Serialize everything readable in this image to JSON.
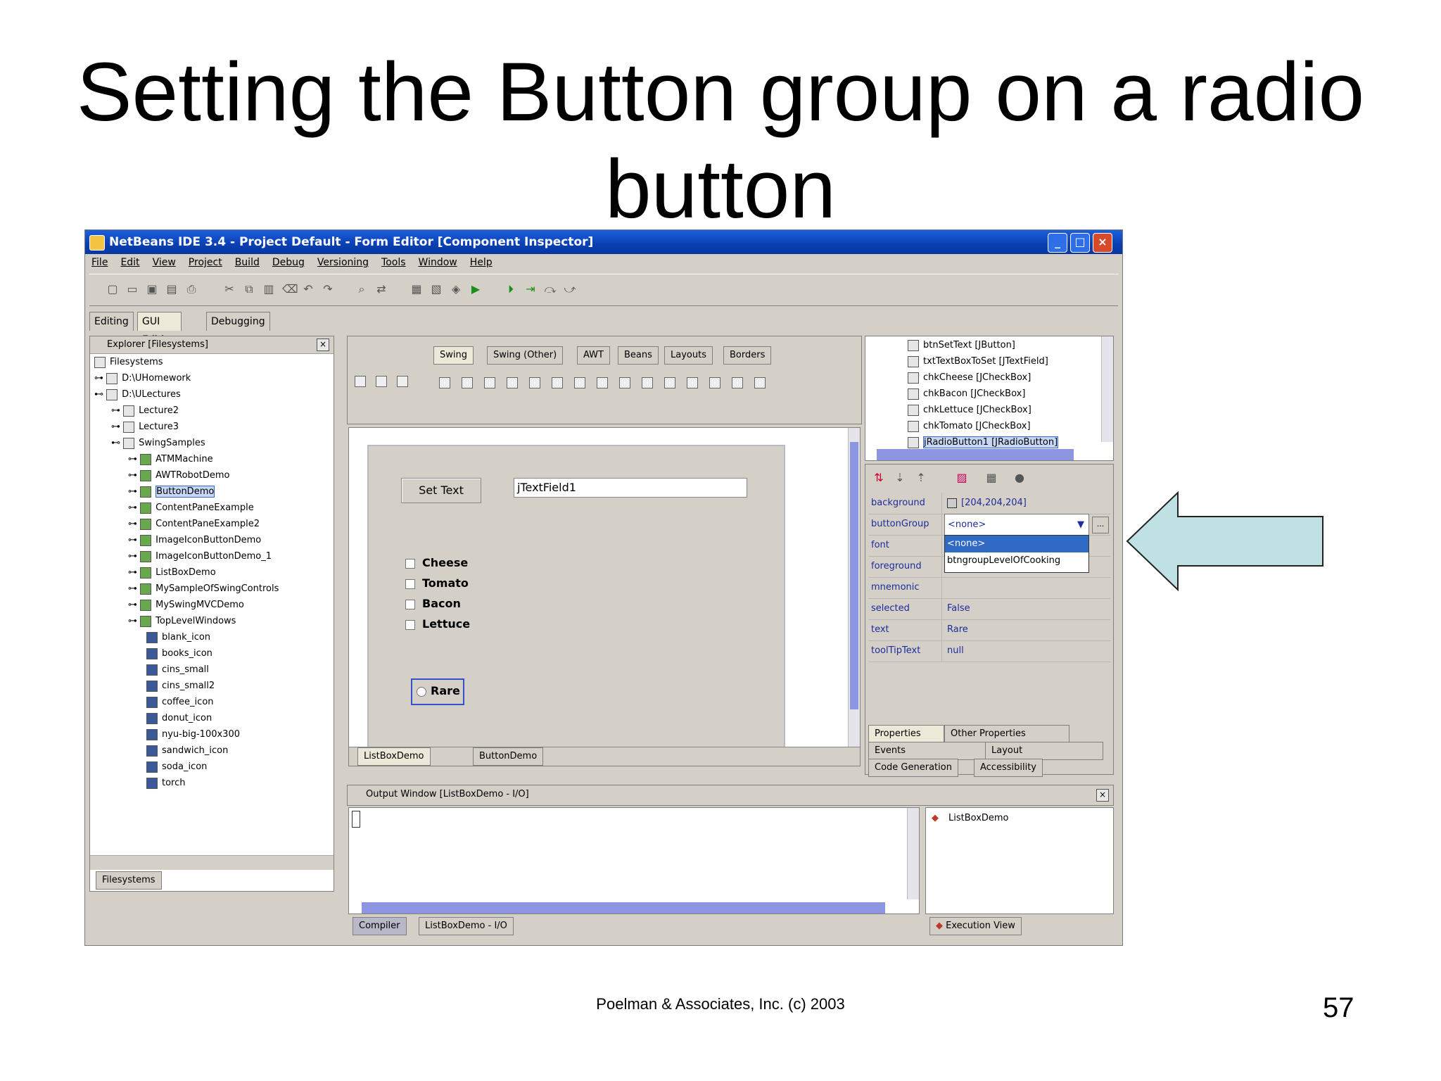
{
  "slide": {
    "title_line1": "Setting the Button group on a radio",
    "title_line2": "button",
    "footer": "Poelman & Associates, Inc. (c) 2003",
    "page_number": "57"
  },
  "window": {
    "title": "NetBeans IDE 3.4 - Project Default - Form Editor [Component Inspector]",
    "menu": [
      "File",
      "Edit",
      "View",
      "Project",
      "Build",
      "Debug",
      "Versioning",
      "Tools",
      "Window",
      "Help"
    ],
    "workspace_tabs": [
      "Editing",
      "GUI Editing",
      "Debugging"
    ]
  },
  "explorer": {
    "title": "Explorer [Filesystems]",
    "items": [
      "Filesystems",
      "D:\\UHomework",
      "D:\\ULectures",
      "Lecture2",
      "Lecture3",
      "SwingSamples",
      "ATMMachine",
      "AWTRobotDemo",
      "ButtonDemo",
      "ContentPaneExample",
      "ContentPaneExample2",
      "ImageIconButtonDemo",
      "ImageIconButtonDemo_1",
      "ListBoxDemo",
      "MySampleOfSwingControls",
      "MySwingMVCDemo",
      "TopLevelWindows",
      "blank_icon",
      "books_icon",
      "cins_small",
      "cins_small2",
      "coffee_icon",
      "donut_icon",
      "nyu-big-100x300",
      "sandwich_icon",
      "soda_icon",
      "torch"
    ],
    "tab": "Filesystems"
  },
  "palette": {
    "tabs": [
      "Swing",
      "Swing (Other)",
      "AWT",
      "Beans",
      "Layouts",
      "Borders"
    ]
  },
  "form": {
    "button_label": "Set Text",
    "textfield_value": "jTextField1",
    "checkboxes": [
      "Cheese",
      "Tomato",
      "Bacon",
      "Lettuce"
    ],
    "radio_label": "Rare",
    "doc_tabs": [
      "ListBoxDemo",
      "ButtonDemo"
    ]
  },
  "inspector": {
    "components": [
      "btnSetText [JButton]",
      "txtTextBoxToSet [JTextField]",
      "chkCheese [JCheckBox]",
      "chkBacon [JCheckBox]",
      "chkLettuce [JCheckBox]",
      "chkTomato [JCheckBox]",
      "jRadioButton1 [JRadioButton]"
    ],
    "properties": [
      {
        "name": "background",
        "value": "[204,204,204]"
      },
      {
        "name": "buttonGroup",
        "value": "<none>"
      },
      {
        "name": "font",
        "value": ""
      },
      {
        "name": "foreground",
        "value": ""
      },
      {
        "name": "mnemonic",
        "value": ""
      },
      {
        "name": "selected",
        "value": "False"
      },
      {
        "name": "text",
        "value": "Rare"
      },
      {
        "name": "toolTipText",
        "value": "null"
      }
    ],
    "dropdown_options": [
      "<none>",
      "btngroupLevelOfCooking"
    ],
    "tabs_row1": [
      "Properties",
      "Other Properties"
    ],
    "tabs_row2": [
      "Events",
      "Layout"
    ],
    "tabs_row3": [
      "Code Generation",
      "Accessibility"
    ]
  },
  "output": {
    "title": "Output Window [ListBoxDemo - I/O]",
    "tabs": [
      "Compiler",
      "ListBoxDemo - I/O"
    ]
  },
  "execution": {
    "item": "ListBoxDemo",
    "tab": "Execution View"
  },
  "colors": {
    "arrow_fill": "#bfe1e3",
    "titlebar": "#0a3fb3",
    "selection": "#316ac5"
  }
}
